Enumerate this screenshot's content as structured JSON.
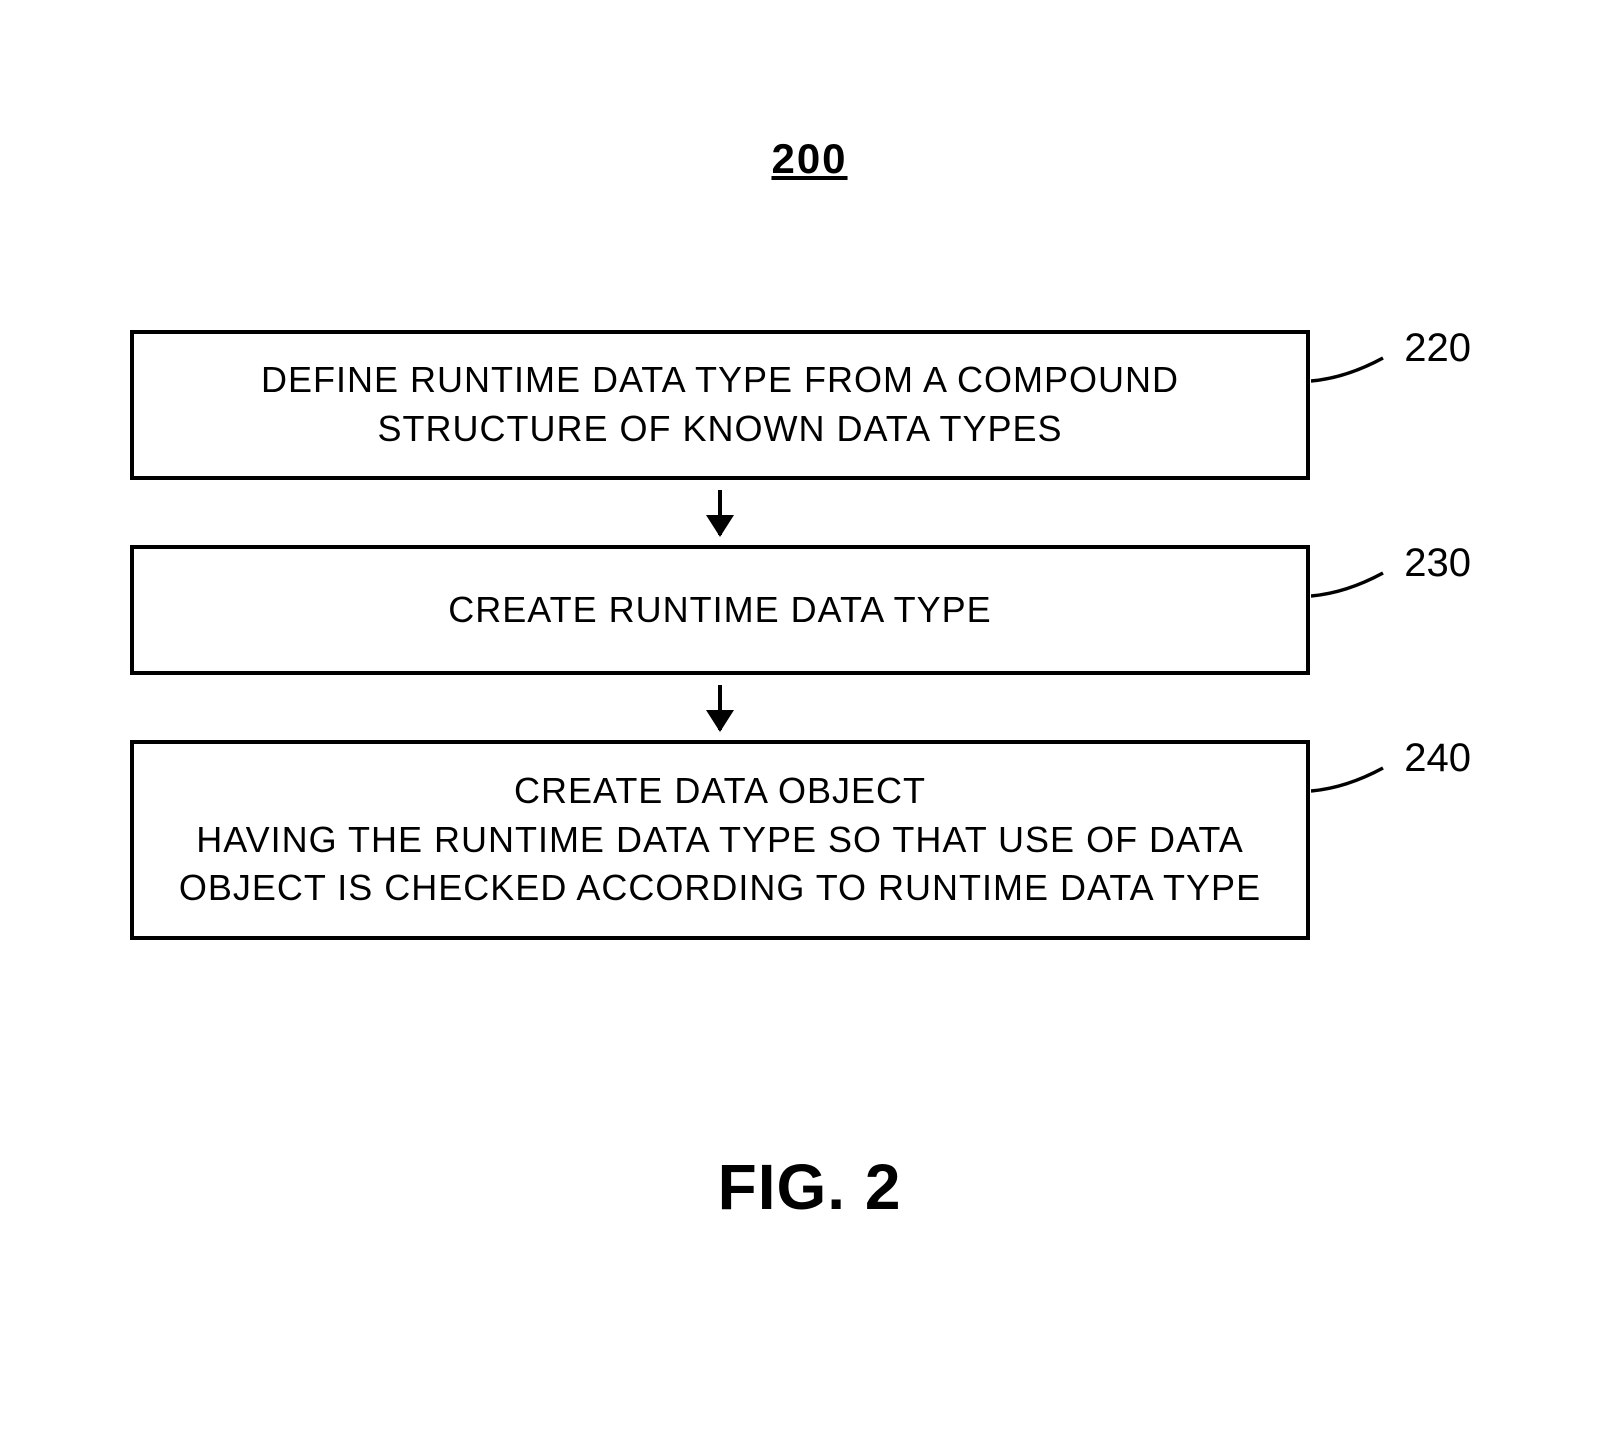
{
  "figure_number": "200",
  "boxes": {
    "b220": {
      "text": "DEFINE RUNTIME DATA TYPE FROM A COMPOUND STRUCTURE OF KNOWN DATA TYPES",
      "ref": "220"
    },
    "b230": {
      "text": "CREATE RUNTIME DATA TYPE",
      "ref": "230"
    },
    "b240": {
      "text": "CREATE DATA OBJECT\nHAVING THE RUNTIME DATA TYPE SO THAT USE OF DATA OBJECT IS CHECKED ACCORDING TO RUNTIME DATA TYPE",
      "ref": "240"
    }
  },
  "figure_caption": "FIG. 2"
}
